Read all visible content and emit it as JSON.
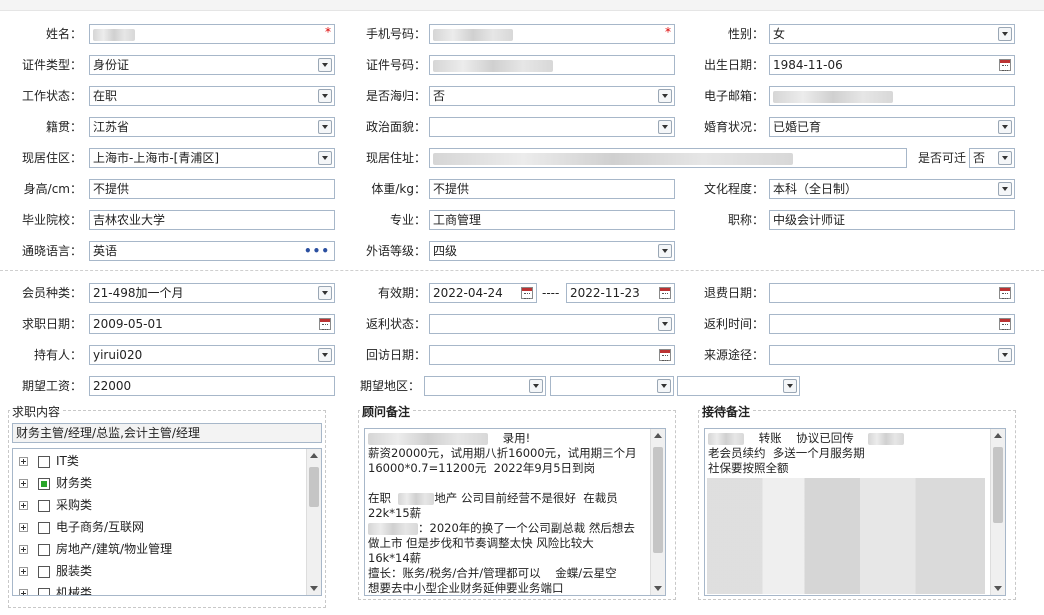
{
  "form": {
    "name_label": "姓名：",
    "phone_label": "手机号码：",
    "gender_label": "性别：",
    "gender_value": "女",
    "idtype_label": "证件类型：",
    "idtype_value": "身份证",
    "idno_label": "证件号码：",
    "birth_label": "出生日期：",
    "birth_value": "1984-11-06",
    "work_label": "工作状态：",
    "work_value": "在职",
    "returnee_label": "是否海归：",
    "returnee_value": "否",
    "email_label": "电子邮箱：",
    "native_label": "籍贯：",
    "native_value": "江苏省",
    "political_label": "政治面貌：",
    "political_value": "",
    "marital_label": "婚育状况：",
    "marital_value": "已婚已育",
    "region_label": "现居住区：",
    "region_value": "上海市-上海市-[青浦区]",
    "address_label": "现居住址：",
    "relocate_label": "是否可迁",
    "relocate_value": "否",
    "height_label": "身高/cm：",
    "height_value": "不提供",
    "weight_label": "体重/kg：",
    "weight_value": "不提供",
    "edu_label": "文化程度：",
    "edu_value": "本科（全日制）",
    "school_label": "毕业院校：",
    "school_value": "吉林农业大学",
    "major_label": "专业：",
    "major_value": "工商管理",
    "title_label": "职称：",
    "title_value": "中级会计师证",
    "lang_label": "通晓语言：",
    "lang_value": "英语",
    "langlevel_label": "外语等级：",
    "langlevel_value": "四级"
  },
  "member": {
    "type_label": "会员种类：",
    "type_value": "21-498加一个月",
    "valid_label": "有效期：",
    "valid_from": "2022-04-24",
    "valid_sep": "----",
    "valid_to": "2022-11-23",
    "refund_label": "退费日期：",
    "jobdate_label": "求职日期：",
    "jobdate_value": "2009-05-01",
    "rebate_status_label": "返利状态：",
    "rebate_time_label": "返利时间：",
    "holder_label": "持有人：",
    "holder_value": "yirui020",
    "visit_label": "回访日期：",
    "source_label": "来源途径：",
    "salary_label": "期望工资：",
    "salary_value": "22000",
    "area_label": "期望地区："
  },
  "job": {
    "section_title": "求职内容",
    "selected": "财务主管/经理/总监,会计主管/经理",
    "tree": [
      {
        "label": "IT类",
        "checked": false
      },
      {
        "label": "财务类",
        "checked": true
      },
      {
        "label": "采购类",
        "checked": false
      },
      {
        "label": "电子商务/互联网",
        "checked": false
      },
      {
        "label": "房地产/建筑/物业管理",
        "checked": false
      },
      {
        "label": "服装类",
        "checked": false
      },
      {
        "label": "机械类",
        "checked": false
      }
    ]
  },
  "advisor": {
    "section_title": "顾问备注",
    "l1": "录用!",
    "l2": "薪资20000元，试用期八折16000元，试用期三个月",
    "l3": "16000*0.7=11200元  2022年9月5日到岗",
    "l4": "在职",
    "l4b": "地产 公司目前经营不是很好  在裁员",
    "l5": "22k*15薪",
    "l6": "：2020年的换了一个公司副总裁 然后想去",
    "l7": "做上市 但是步伐和节奏调整太快 风险比较大",
    "l8": "16k*14薪",
    "l9": "擅长：账务/税务/合并/管理都可以    金蝶/云星空",
    "l10": "想要去中小型企业财务延伸要业务端口"
  },
  "reception": {
    "section_title": "接待备注",
    "l1a": "转账",
    "l1b": "协议已回传",
    "l2": "老会员续约  多送一个月服务期",
    "l3": "社保要按照全额"
  }
}
